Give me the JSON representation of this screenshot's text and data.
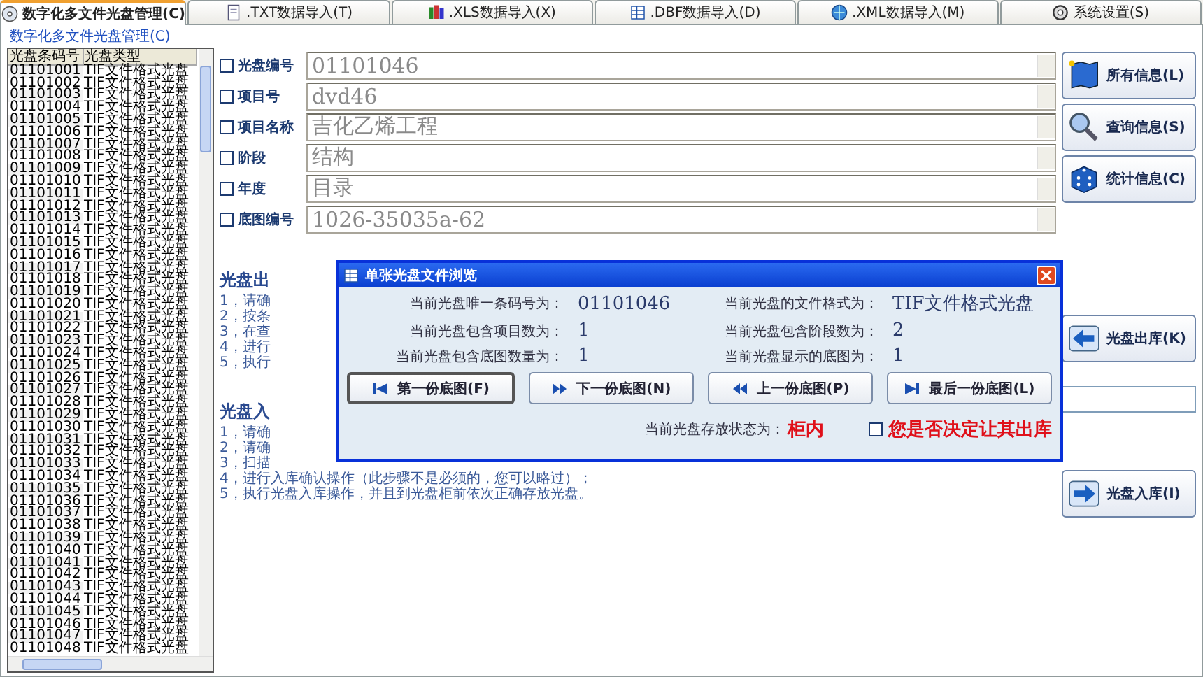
{
  "tabs": [
    {
      "label": "数字化多文件光盘管理(C)",
      "kind": "disc",
      "selected": true
    },
    {
      "label": ".TXT数据导入(T)",
      "kind": "txt",
      "selected": false
    },
    {
      "label": ".XLS数据导入(X)",
      "kind": "xls",
      "selected": false
    },
    {
      "label": ".DBF数据导入(D)",
      "kind": "dbf",
      "selected": false
    },
    {
      "label": ".XML数据导入(M)",
      "kind": "xml",
      "selected": false
    },
    {
      "label": "系统设置(S)",
      "kind": "settings",
      "selected": false
    }
  ],
  "group_title": "数字化多文件光盘管理(C)",
  "disc_list": {
    "columns": [
      "光盘条码号",
      "光盘类型"
    ],
    "rows": [
      [
        "01101001",
        "TIF文件格式光盘"
      ],
      [
        "01101002",
        "TIF文件格式光盘"
      ],
      [
        "01101003",
        "TIF文件格式光盘"
      ],
      [
        "01101004",
        "TIF文件格式光盘"
      ],
      [
        "01101005",
        "TIF文件格式光盘"
      ],
      [
        "01101006",
        "TIF文件格式光盘"
      ],
      [
        "01101007",
        "TIF文件格式光盘"
      ],
      [
        "01101008",
        "TIF文件格式光盘"
      ],
      [
        "01101009",
        "TIF文件格式光盘"
      ],
      [
        "01101010",
        "TIF文件格式光盘"
      ],
      [
        "01101011",
        "TIF文件格式光盘"
      ],
      [
        "01101012",
        "TIF文件格式光盘"
      ],
      [
        "01101013",
        "TIF文件格式光盘"
      ],
      [
        "01101014",
        "TIF文件格式光盘"
      ],
      [
        "01101015",
        "TIF文件格式光盘"
      ],
      [
        "01101016",
        "TIF文件格式光盘"
      ],
      [
        "01101017",
        "TIF文件格式光盘"
      ],
      [
        "01101018",
        "TIF文件格式光盘"
      ],
      [
        "01101019",
        "TIF文件格式光盘"
      ],
      [
        "01101020",
        "TIF文件格式光盘"
      ],
      [
        "01101021",
        "TIF文件格式光盘"
      ],
      [
        "01101022",
        "TIF文件格式光盘"
      ],
      [
        "01101023",
        "TIF文件格式光盘"
      ],
      [
        "01101024",
        "TIF文件格式光盘"
      ],
      [
        "01101025",
        "TIF文件格式光盘"
      ],
      [
        "01101026",
        "TIF文件格式光盘"
      ],
      [
        "01101027",
        "TIF文件格式光盘"
      ],
      [
        "01101028",
        "TIF文件格式光盘"
      ],
      [
        "01101029",
        "TIF文件格式光盘"
      ],
      [
        "01101030",
        "TIF文件格式光盘"
      ],
      [
        "01101031",
        "TIF文件格式光盘"
      ],
      [
        "01101032",
        "TIF文件格式光盘"
      ],
      [
        "01101033",
        "TIF文件格式光盘"
      ],
      [
        "01101034",
        "TIF文件格式光盘"
      ],
      [
        "01101035",
        "TIF文件格式光盘"
      ],
      [
        "01101036",
        "TIF文件格式光盘"
      ],
      [
        "01101037",
        "TIF文件格式光盘"
      ],
      [
        "01101038",
        "TIF文件格式光盘"
      ],
      [
        "01101039",
        "TIF文件格式光盘"
      ],
      [
        "01101040",
        "TIF文件格式光盘"
      ],
      [
        "01101041",
        "TIF文件格式光盘"
      ],
      [
        "01101042",
        "TIF文件格式光盘"
      ],
      [
        "01101043",
        "TIF文件格式光盘"
      ],
      [
        "01101044",
        "TIF文件格式光盘"
      ],
      [
        "01101045",
        "TIF文件格式光盘"
      ],
      [
        "01101046",
        "TIF文件格式光盘"
      ],
      [
        "01101047",
        "TIF文件格式光盘"
      ],
      [
        "01101048",
        "TIF文件格式光盘"
      ]
    ]
  },
  "fields": [
    {
      "label": "光盘编号",
      "checked": false,
      "disabled": true,
      "value": "01101046"
    },
    {
      "label": "项目号",
      "checked": false,
      "disabled": true,
      "value": "dvd46"
    },
    {
      "label": "项目名称",
      "checked": false,
      "disabled": true,
      "value": "吉化乙烯工程"
    },
    {
      "label": "阶段",
      "checked": false,
      "disabled": true,
      "value": "结构"
    },
    {
      "label": "年度",
      "checked": false,
      "disabled": true,
      "value": "目录"
    },
    {
      "label": "底图编号",
      "checked": false,
      "disabled": true,
      "value": "1026-35035a-62"
    }
  ],
  "side_buttons": [
    {
      "label": "所有信息(L)",
      "kind": "map"
    },
    {
      "label": "查询信息(S)",
      "kind": "search"
    },
    {
      "label": "统计信息(C)",
      "kind": "cube"
    }
  ],
  "checkout_button": {
    "label": "光盘出库(K)",
    "kind": "out"
  },
  "checkin_button": {
    "label": "光盘入库(I)",
    "kind": "in"
  },
  "instructions": [
    {
      "title": "光盘出",
      "steps": [
        "1，请确",
        "2，按条",
        "3，在查",
        "4，进行",
        "5，执行"
      ]
    },
    {
      "title": "光盘入",
      "steps": [
        "1，请确",
        "2，请确",
        "3，扫描",
        "4，进行入库确认操作（此步骤不是必须的，您可以略过）；",
        "5，执行光盘入库操作，并且到光盘柜前依次正确存放光盘。"
      ]
    }
  ],
  "dialog": {
    "title": "单张光盘文件浏览",
    "info": [
      {
        "label": "当前光盘唯一条码号为：",
        "value": "01101046"
      },
      {
        "label": "当前光盘的文件格式为：",
        "value": "TIF文件格式光盘"
      },
      {
        "label": "当前光盘包含项目数为：",
        "value": "1"
      },
      {
        "label": "当前光盘包含阶段数为：",
        "value": "2"
      },
      {
        "label": "当前光盘包含底图数量为：",
        "value": "1"
      },
      {
        "label": "当前光盘显示的底图为：",
        "value": "1"
      }
    ],
    "buttons": [
      {
        "label": "第一份底图(F)",
        "kind": "first",
        "focused": true
      },
      {
        "label": "下一份底图(N)",
        "kind": "next",
        "focused": false
      },
      {
        "label": "上一份底图(P)",
        "kind": "prev",
        "focused": false
      },
      {
        "label": "最后一份底图(L)",
        "kind": "last",
        "focused": false
      }
    ],
    "status_label": "当前光盘存放状态为：",
    "status": "柜内",
    "checkout_check": {
      "label": "您是否决定让其出库",
      "checked": false
    }
  }
}
